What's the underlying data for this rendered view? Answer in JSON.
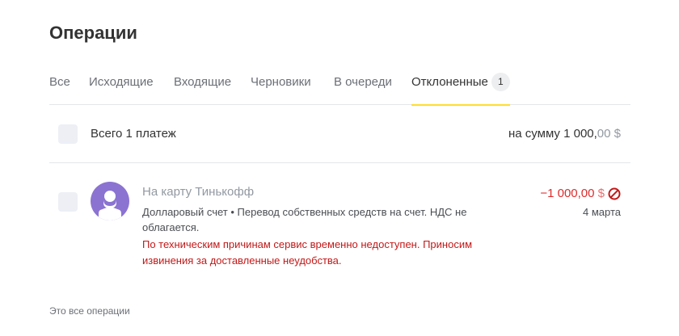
{
  "page": {
    "title": "Операции"
  },
  "tabs": [
    {
      "label": "Все",
      "active": false
    },
    {
      "label": "Исходящие",
      "active": false
    },
    {
      "label": "Входящие",
      "active": false
    },
    {
      "label": "Черновики",
      "active": false
    },
    {
      "label": "В очереди",
      "active": false
    },
    {
      "label": "Отклоненные",
      "active": true,
      "badge": "1"
    }
  ],
  "summary": {
    "label": "Всего 1 платеж",
    "amount_prefix": "на сумму 1 000,",
    "amount_fraction": "00",
    "currency": "$"
  },
  "operation": {
    "avatar_icon": "user-silhouette-icon",
    "title": "На карту Тинькофф",
    "description": "Долларовый счет • Перевод собственных средств на счет. НДС не облагается.",
    "error": "По техническим причинам сервис временно недоступен. Приносим извинения за доставленные неудобства.",
    "amount": "−1 000,00",
    "currency": "$",
    "status_icon": "declined-icon",
    "date": "4 марта"
  },
  "footer": {
    "note": "Это все операции"
  },
  "colors": {
    "accent": "#ffdd2d",
    "avatar": "#8b73d2",
    "error": "#c21818",
    "negative_amount": "#dd2c2c",
    "muted": "#9299a2"
  }
}
